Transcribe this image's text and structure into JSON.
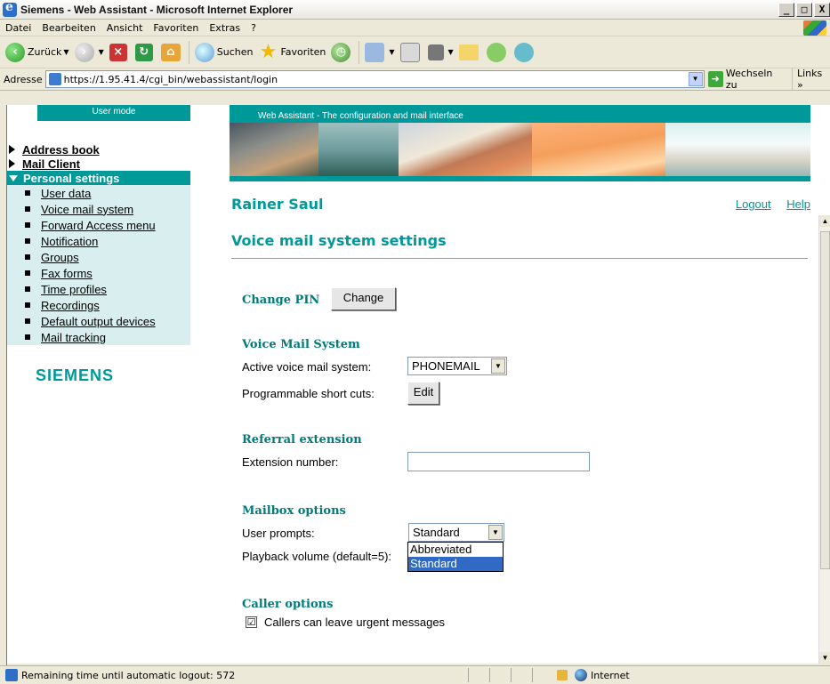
{
  "window": {
    "title": "Siemens - Web Assistant - Microsoft Internet Explorer",
    "minimize": "_",
    "maximize": "□",
    "close": "X"
  },
  "menu": [
    "Datei",
    "Bearbeiten",
    "Ansicht",
    "Favoriten",
    "Extras",
    "?"
  ],
  "toolbar": {
    "back_label": "Zurück",
    "search_label": "Suchen",
    "favorites_label": "Favoriten"
  },
  "address": {
    "label": "Adresse",
    "url": "https://1.95.41.4/cgi_bin/webassistant/login",
    "go_label": "Wechseln zu",
    "links_label": "Links »"
  },
  "nav": {
    "user_mode": "User mode",
    "items": [
      {
        "label": "Address book"
      },
      {
        "label": "Mail Client"
      },
      {
        "label": "Personal settings"
      }
    ],
    "sub_items": [
      "User data",
      "Voice mail system",
      "Forward Access menu",
      "Notification",
      "Groups",
      "Fax forms",
      "Time profiles",
      "Recordings",
      "Default output devices",
      "Mail tracking"
    ],
    "logo": "SIEMENS"
  },
  "banner": {
    "title": "Web Assistant - The configuration and mail interface"
  },
  "header": {
    "username": "Rainer Saul",
    "logout": "Logout",
    "help": "Help"
  },
  "page": {
    "title": "Voice mail system settings",
    "change_pin": {
      "label": "Change PIN",
      "button": "Change"
    },
    "voice_mail_system": {
      "heading": "Voice Mail System",
      "active_label": "Active voice mail system:",
      "active_value": "PHONEMAIL",
      "shortcuts_label": "Programmable short cuts:",
      "edit_button": "Edit"
    },
    "referral": {
      "heading": "Referral extension",
      "ext_label": "Extension number:",
      "ext_value": ""
    },
    "mailbox": {
      "heading": "Mailbox options",
      "prompts_label": "User prompts:",
      "prompts_value": "Standard",
      "prompts_options": [
        "Abbreviated",
        "Standard"
      ],
      "volume_label": "Playback volume (default=5):"
    },
    "caller": {
      "heading": "Caller options",
      "urgent_label": "Callers can leave urgent messages",
      "urgent_checked": "☑"
    }
  },
  "status": {
    "text": "Remaining time until automatic logout: 572",
    "zone": "Internet"
  }
}
